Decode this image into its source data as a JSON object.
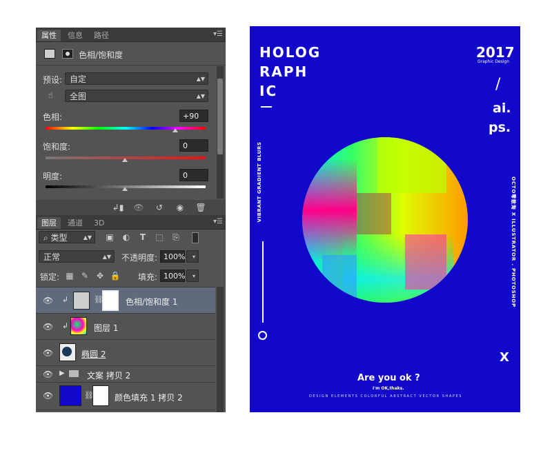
{
  "properties_panel": {
    "tabs": [
      "属性",
      "信息",
      "路径"
    ],
    "adjustment_title": "色相/饱和度",
    "preset_label": "预设:",
    "preset_value": "自定",
    "range_value": "全图",
    "hue_label": "色相:",
    "hue_value": "+90",
    "saturation_label": "饱和度:",
    "saturation_value": "0",
    "lightness_label": "明度:",
    "lightness_value": "0"
  },
  "layers_panel": {
    "tabs": [
      "图层",
      "通道",
      "3D"
    ],
    "filter_kind": "类型",
    "blend_mode": "正常",
    "opacity_label": "不透明度:",
    "opacity_value": "100%",
    "lock_label": "锁定:",
    "fill_label": "填充:",
    "fill_value": "100%",
    "layers": [
      {
        "name": "色相/饱和度 1",
        "type": "adjustment",
        "selected": true
      },
      {
        "name": "图层 1",
        "type": "pixel"
      },
      {
        "name": "椭圆 2",
        "type": "shape"
      },
      {
        "name": "文案 拷贝 2",
        "type": "group"
      },
      {
        "name": "颜色填充 1 拷贝 2",
        "type": "fill"
      }
    ]
  },
  "poster": {
    "title_lines": [
      "HOLOG",
      "RAPH",
      "IC"
    ],
    "year": "2017",
    "year_sub": "Graphic Design",
    "slash": "/",
    "apps": [
      "ai.",
      "ps."
    ],
    "left_vertical": "VIBRANT GRADIENT BLURS",
    "right_vertical": "OCTO零散淘 X ILLUSTRATOR . PHOTOSHOP",
    "x_mark": "X",
    "question": "Are you ok ?",
    "answer": "I'm OK,thaks.",
    "footer": "DESIGN ELEMENTS COLORFUL ABSTRACT VECTOR SHAPES",
    "colors": {
      "background": "#1208cc"
    }
  }
}
